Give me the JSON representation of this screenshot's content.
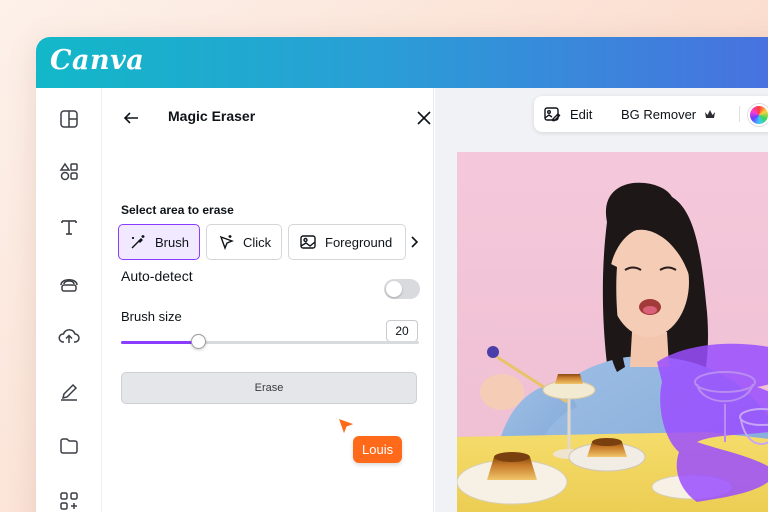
{
  "app": {
    "logo": "Canva"
  },
  "rail": {
    "items": [
      "layout-icon",
      "elements-icon",
      "text-icon",
      "brand-icon",
      "uploads-icon",
      "draw-icon",
      "projects-icon",
      "apps-icon"
    ]
  },
  "panel": {
    "title": "Magic Eraser",
    "section_label": "Select area to erase",
    "modes": [
      {
        "label": "Brush",
        "icon": "magic-brush-icon",
        "active": true
      },
      {
        "label": "Click",
        "icon": "magic-click-icon",
        "active": false
      },
      {
        "label": "Foreground",
        "icon": "foreground-image-icon",
        "active": false
      }
    ],
    "auto_detect_label": "Auto-detect",
    "auto_detect_on": false,
    "brush_size_label": "Brush size",
    "brush_size_value": "20",
    "brush_size_fraction": 0.26,
    "erase_label": "Erase"
  },
  "cursor": {
    "name": "Louis",
    "color": "#ff6a1a"
  },
  "toolbar": {
    "edit_label": "Edit",
    "bg_remover_label": "BG Remover"
  },
  "colors": {
    "accent": "#8b3dff",
    "topbar_start": "#12b8c8",
    "topbar_end": "#4a6fe0",
    "photo_background": "#f3c6d8",
    "table": "#f2d661"
  }
}
